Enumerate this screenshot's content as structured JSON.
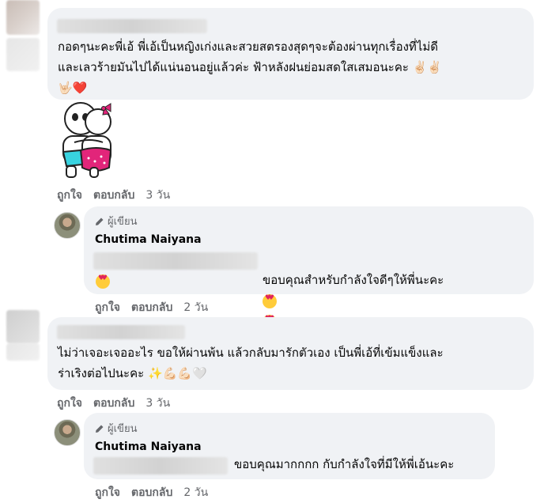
{
  "comments": [
    {
      "text": "กอดๆนะคะพี่เอ้ พี่เอ้เป็นหญิงเก่งและสวยสตรองสุดๆจะต้องผ่านทุกเรื่องที่ไม่ดี\nและเลวร้ายมันไปได้แน่นอนอยู่แล้วค่ะ ฟ้าหลังฝนย่อมสดใสเสมอนะคะ ✌🏻✌🏻\n🤟🏻❤️",
      "like_label": "ถูกใจ",
      "reply_label": "ตอบกลับ",
      "time": "3 วัน",
      "sticker": "hug-sticker",
      "reply": {
        "author_badge": "ผู้เขียน",
        "author_name": "Chutima Naiyana",
        "text": "ขอบคุณสำหรับกำลังใจดีๆให้พี่นะคะ",
        "emojis": [
          "heart-eyes",
          "heart-eyes",
          "heart-eyes"
        ],
        "like_label": "ถูกใจ",
        "reply_label": "ตอบกลับ",
        "time": "2 วัน"
      }
    },
    {
      "text": "ไม่ว่าเจอะเจออะไร ขอให้ผ่านพ้น แล้วกลับมารักตัวเอง เป็นพี่เอ้ที่เข้มแข็งและ\nร่าเริงต่อไปนะคะ ✨💪🏻💪🏻🤍",
      "like_label": "ถูกใจ",
      "reply_label": "ตอบกลับ",
      "time": "3 วัน",
      "reply": {
        "author_badge": "ผู้เขียน",
        "author_name": "Chutima Naiyana",
        "text": "ขอบคุณมากกกก กับกำลังใจที่มีให้พี่เอ้นะคะ",
        "like_label": "ถูกใจ",
        "reply_label": "ตอบกลับ",
        "time": "2 วัน"
      }
    }
  ],
  "icons": {
    "author_badge_icon": "pencil-icon"
  },
  "colors": {
    "bubble": "#f0f2f5",
    "secondary_text": "#65676b"
  }
}
